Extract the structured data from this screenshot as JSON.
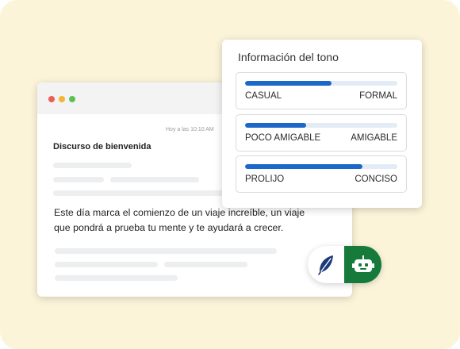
{
  "email": {
    "timestamp": "Hoy a las 10:10 AM",
    "subject": "Discurso de bienvenida",
    "body": "Este día marca el comienzo de un viaje increíble, un viaje que pondrá a prueba tu mente y te ayudará a crecer."
  },
  "tone_panel": {
    "title": "Información del tono",
    "rows": [
      {
        "left_label": "CASUAL",
        "right_label": "FORMAL",
        "level": 0.57
      },
      {
        "left_label": "POCO AMIGABLE",
        "right_label": "AMIGABLE",
        "level": 0.4
      },
      {
        "left_label": "PROLIJO",
        "right_label": "CONCISO",
        "level": 0.77
      }
    ]
  },
  "colors": {
    "background": "#fbf4d9",
    "accent_blue": "#1b68c8",
    "track": "#e3ecf6",
    "bot_button": "#157a3a",
    "feather_icon": "#1a3a78"
  },
  "icons": {
    "feather": "feather-icon",
    "bot": "bot-icon"
  }
}
